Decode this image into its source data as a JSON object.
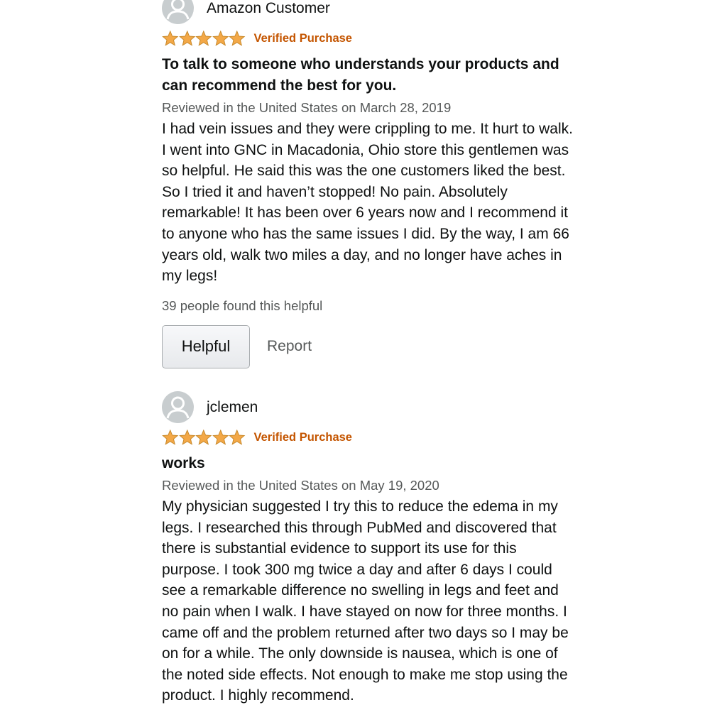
{
  "reviews": [
    {
      "profile_name": "Amazon Customer",
      "rating": 5,
      "verified_label": "Verified Purchase",
      "title": "To talk to someone who understands your products and can recommend the best for you.",
      "meta": "Reviewed in the United States on March 28, 2019",
      "body": "I had vein issues and they were crippling to me. It hurt to walk. I went into GNC in Macadonia, Ohio store this gentlemen was so helpful. He said this was the one customers liked the best. So I tried it and haven’t stopped! No pain. Absolutely remarkable! It has been over 6 years now and I recommend it to anyone who has the same issues I did. By the way, I am 66 years old, walk two miles a day, and no longer have aches in my legs!",
      "helpful_count": "39 people found this helpful",
      "helpful_button": "Helpful",
      "report_link": "Report"
    },
    {
      "profile_name": "jclemen",
      "rating": 5,
      "verified_label": "Verified Purchase",
      "title": "works",
      "meta": "Reviewed in the United States on May 19, 2020",
      "body": "My physician suggested I try this to reduce the edema in my legs. I researched this through PubMed and discovered that there is substantial evidence to support its use for this purpose. I took 300 mg twice a day and after 6 days I could see a remarkable difference no swelling in legs and feet and no pain when I walk. I have stayed on now for three months. I came off and the problem returned after two days so I may be on for a while. The only downside is nausea, which is one of the noted side effects. Not enough to make me stop using the product. I highly recommend."
    }
  ],
  "colors": {
    "star_fill": "#f3a847",
    "star_stroke": "#c7892b",
    "verified": "#c45500",
    "meta_text": "#565959",
    "avatar_bg": "#c8cdcf"
  },
  "icons": {
    "avatar": "user-avatar-icon",
    "star": "star-icon"
  }
}
